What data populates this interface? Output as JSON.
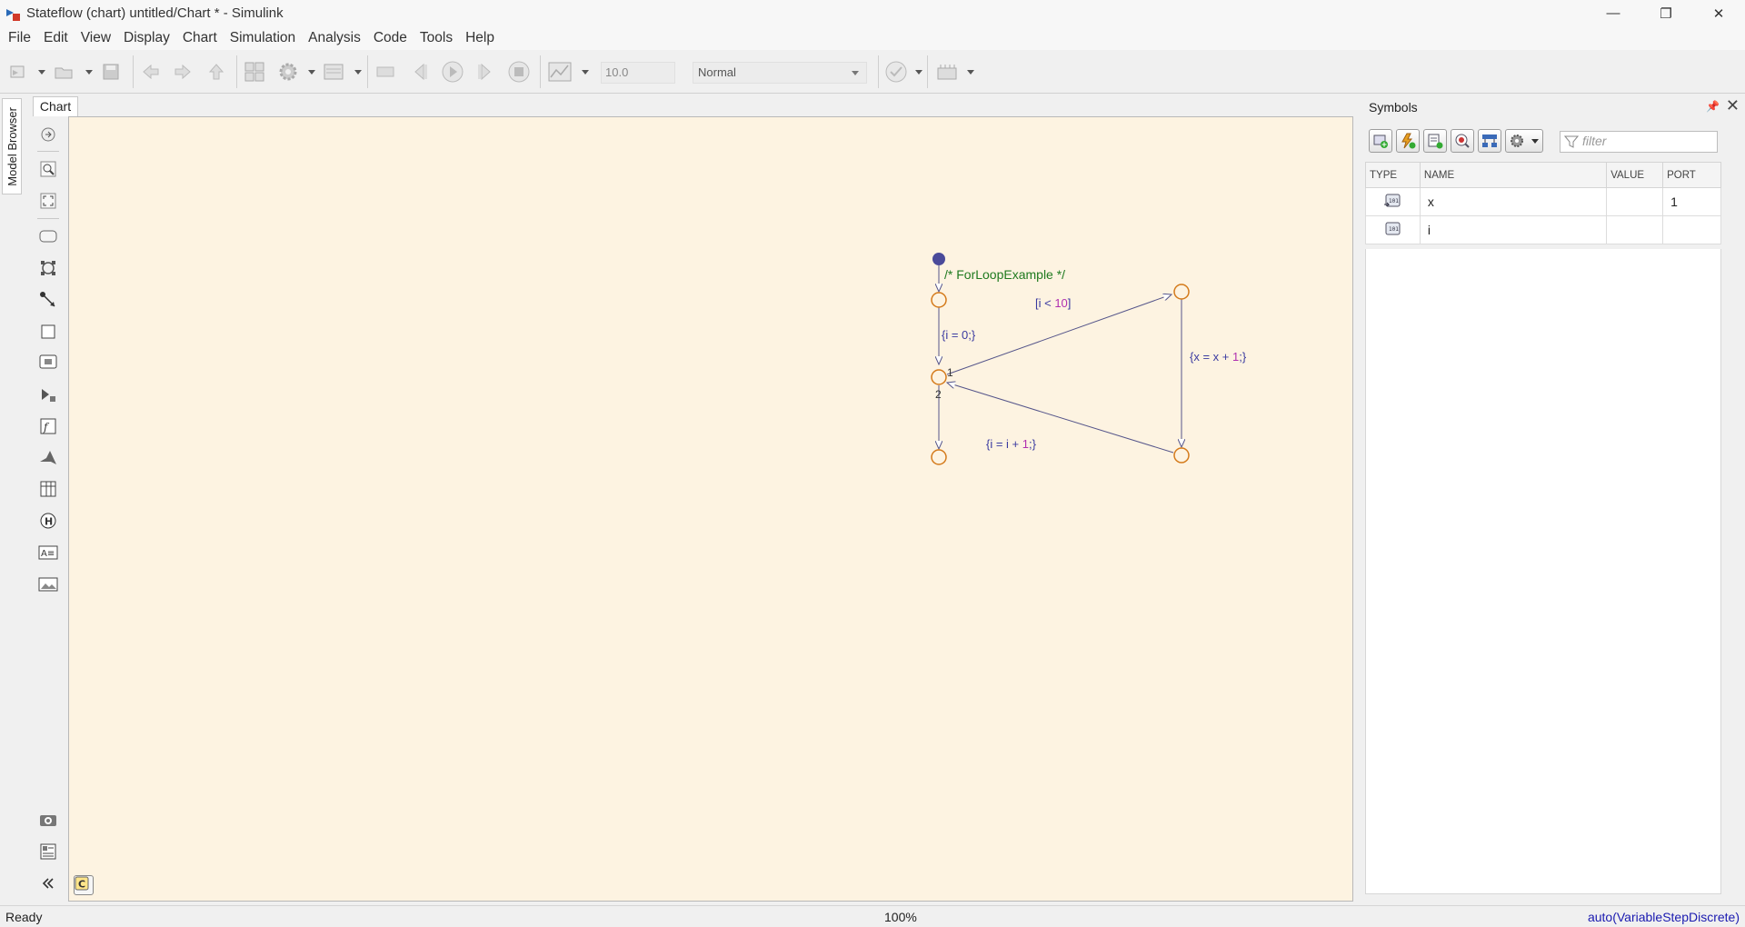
{
  "window": {
    "title": "Stateflow (chart) untitled/Chart * - Simulink",
    "minimize": "—",
    "restore": "❐",
    "close": "✕"
  },
  "menu": [
    "File",
    "Edit",
    "View",
    "Display",
    "Chart",
    "Simulation",
    "Analysis",
    "Code",
    "Tools",
    "Help"
  ],
  "toolbar": {
    "stop_time": "10.0",
    "sim_mode": "Normal"
  },
  "model_browser": {
    "label": "Model Browser"
  },
  "editor": {
    "tab": "Chart"
  },
  "chart": {
    "comment": "/* ForLoopExample */",
    "init_action": "{i = 0;}",
    "condition_prefix": "[i < ",
    "condition_num": "10",
    "condition_suffix": "]",
    "body_prefix": "{x = x + ",
    "body_num": "1",
    "body_suffix": ";}",
    "incr_prefix": "{i = i + ",
    "incr_num": "1",
    "incr_suffix": ";}",
    "order_1": "1",
    "order_2": "2",
    "colors": {
      "canvas": "#fdf3e1",
      "junction": "#d47a1a",
      "default_dot": "#4a4a9a",
      "transition": "#55558a",
      "comment": "#1f7a1f",
      "label": "#3a3aa0",
      "number": "#b030b0"
    }
  },
  "symbols": {
    "title": "Symbols",
    "filter_placeholder": "filter",
    "columns": [
      "TYPE",
      "NAME",
      "VALUE",
      "PORT"
    ],
    "rows": [
      {
        "type_icon": "input-data-icon",
        "name": "x",
        "value": "",
        "port": "1"
      },
      {
        "type_icon": "local-data-icon",
        "name": "i",
        "value": "",
        "port": ""
      }
    ]
  },
  "status": {
    "left": "Ready",
    "zoom": "100%",
    "solver": "auto(VariableStepDiscrete)"
  }
}
